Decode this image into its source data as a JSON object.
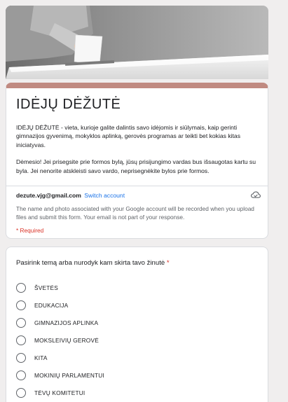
{
  "banner": {
    "image": "ballot-box-photo"
  },
  "form": {
    "title": "IDĖJŲ DĖŽUTĖ",
    "description_1": "IDĖJŲ DĖŽUTĖ - vieta, kurioje galite dalintis savo idėjomis ir siūlymais, kaip gerinti gimnazijos gyvenimą, mokyklos aplinką, gerovės programas ar teikti bet kokias kitas iniciatyvas.",
    "description_2": "Dėmesio! Jei prisegsite prie formos bylą, jūsų prisijungimo vardas bus išsaugotas kartu su byla. Jei nenorite atskleisti savo vardo, neprisegnėkite bylos prie formos.",
    "account_email": "dezute.vjg@gmail.com",
    "switch_account": "Switch account",
    "notice": "The name and photo associated with your Google account will be recorded when you upload files and submit this form. Your email is not part of your response.",
    "required_note": "* Required"
  },
  "question": {
    "title": "Pasirink temą arba nurodyk kam skirta tavo žinutė",
    "required_mark": "*",
    "options": [
      "ŠVETĖS",
      "EDUKACIJA",
      "GIMNAZIJOS APLINKA",
      "MOKSLEIVIŲ GEROVĖ",
      "KITA",
      "MOKINIŲ PARLAMENTUI",
      "TĖVŲ KOMITETUI"
    ]
  },
  "colors": {
    "accent": "#c08a81",
    "link": "#1a73e8",
    "required": "#d93025"
  }
}
